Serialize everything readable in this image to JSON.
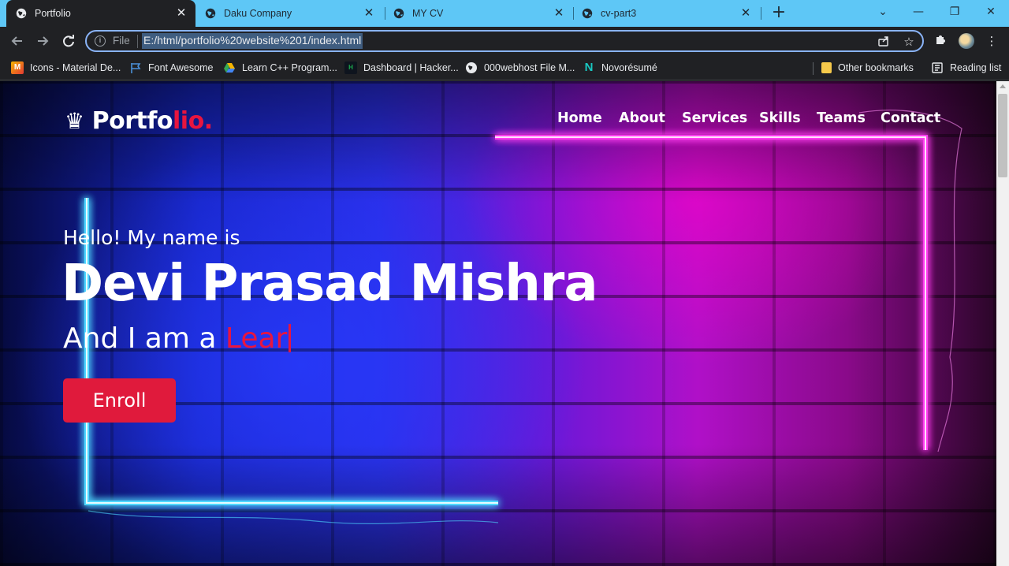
{
  "browser": {
    "tabs": [
      {
        "title": "Portfolio",
        "active": true
      },
      {
        "title": "Daku Company",
        "active": false
      },
      {
        "title": "MY CV",
        "active": false
      },
      {
        "title": "cv-part3",
        "active": false
      }
    ],
    "tab_close_glyph": "✕",
    "new_tab_glyph": "+",
    "window_controls": {
      "dropdown": "⌄",
      "minimize": "—",
      "maximize": "❐",
      "close": "✕"
    },
    "address_bar": {
      "scheme_label": "File",
      "url": "E:/html/portfolio%20website%201/index.html"
    },
    "bookmarks": [
      {
        "label": "Icons - Material De...",
        "icon": "material-icons-icon",
        "color": "#f4b400"
      },
      {
        "label": "Font Awesome",
        "icon": "flag-icon",
        "color": "#4a90d9"
      },
      {
        "label": "Learn C++ Program...",
        "icon": "google-drive-icon",
        "color": "#34a853"
      },
      {
        "label": "Dashboard | Hacker...",
        "icon": "hackerrank-icon",
        "color": "#1ba94c"
      },
      {
        "label": "000webhost File M...",
        "icon": "globe-icon",
        "color": "#e8eaed"
      },
      {
        "label": "Novorésumé",
        "icon": "novoresume-icon",
        "color": "#19c7c1"
      }
    ],
    "other_bookmarks": "Other bookmarks",
    "reading_list": "Reading list"
  },
  "site": {
    "logo": {
      "main": "Portfo",
      "accent": "lio."
    },
    "nav": [
      "Home",
      "About",
      "Services",
      "Skills",
      "Teams",
      "Contact"
    ],
    "hero": {
      "greeting": "Hello! My name is",
      "name": "Devi Prasad Mishra",
      "role_prefix": "And I am a",
      "role_typed": "Lear",
      "cta": "Enroll"
    },
    "colors": {
      "accent": "#e8153f",
      "neon_cyan": "#4fd8ff",
      "neon_pink": "#ff3cf0"
    }
  }
}
